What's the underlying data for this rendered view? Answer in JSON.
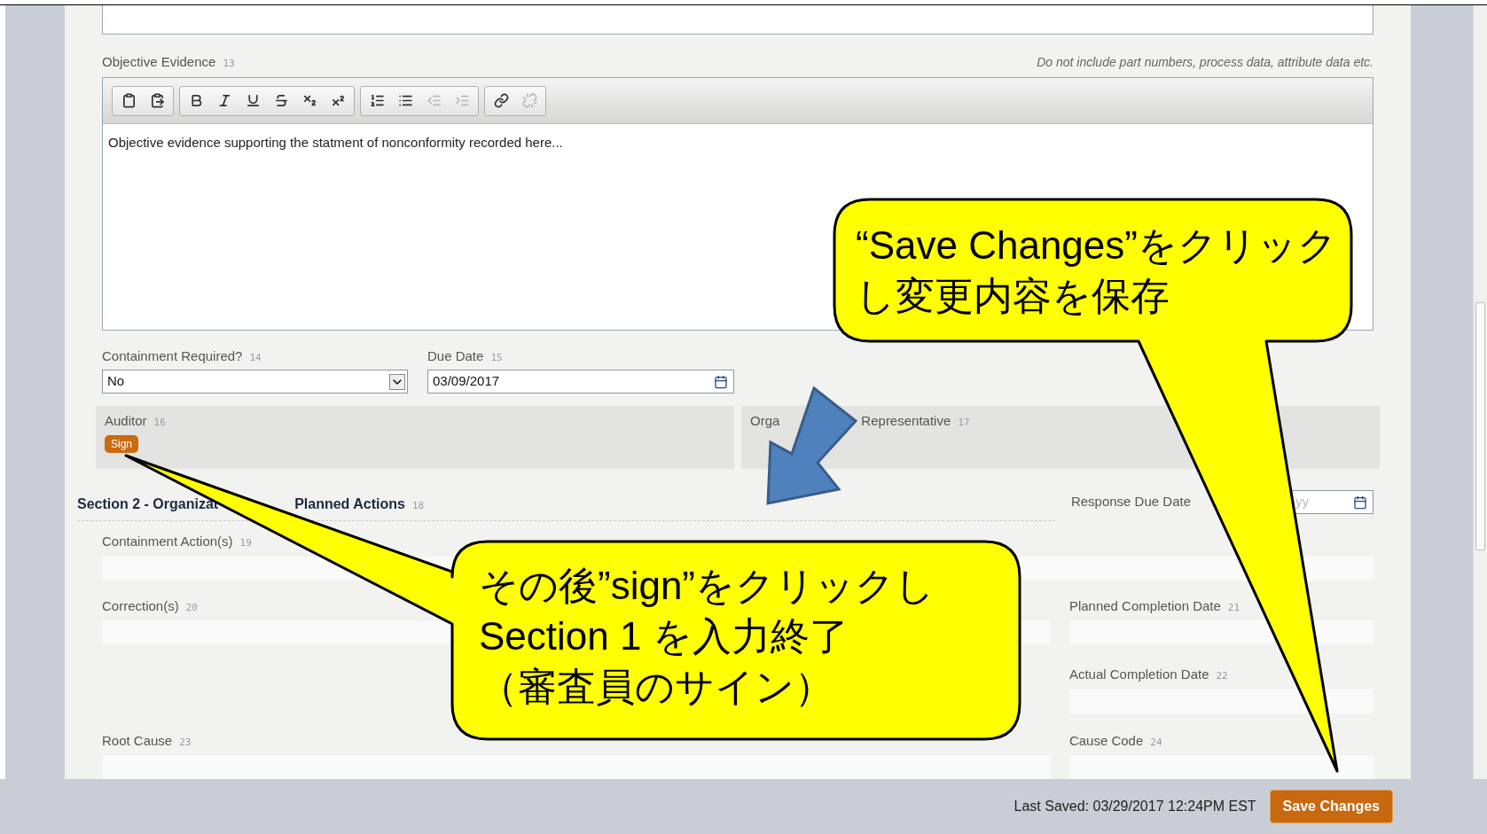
{
  "objective_evidence": {
    "label": "Objective Evidence",
    "number": "13",
    "hint": "Do not include part numbers, process data, attribute data etc.",
    "text": "Objective evidence supporting the statment of nonconformity recorded here...",
    "toolbar_groups": [
      [
        {
          "kind": "paste-text",
          "disabled": false
        },
        {
          "kind": "paste-word",
          "disabled": false
        }
      ],
      [
        {
          "kind": "bold",
          "disabled": false
        },
        {
          "kind": "italic",
          "disabled": false
        },
        {
          "kind": "underline",
          "disabled": false
        },
        {
          "kind": "strike",
          "disabled": false
        },
        {
          "kind": "subscript",
          "disabled": false
        },
        {
          "kind": "superscript",
          "disabled": false
        }
      ],
      [
        {
          "kind": "ordered-list",
          "disabled": false
        },
        {
          "kind": "bullet-list",
          "disabled": false
        },
        {
          "kind": "outdent",
          "disabled": true
        },
        {
          "kind": "indent",
          "disabled": true
        }
      ],
      [
        {
          "kind": "link",
          "disabled": false
        },
        {
          "kind": "unlink",
          "disabled": true
        }
      ]
    ]
  },
  "containment": {
    "label": "Containment Required?",
    "number": "14",
    "value": "No"
  },
  "due_date": {
    "label": "Due Date",
    "number": "15",
    "value": "03/09/2017"
  },
  "signatures": [
    {
      "label_parts": [
        "Auditor"
      ],
      "number": "16",
      "button": "Sign"
    },
    {
      "label_parts": [
        "Orga",
        "Representative"
      ],
      "number": "17"
    }
  ],
  "section2": {
    "title_parts": [
      "Section 2 - Organizat",
      "Planned Actions"
    ],
    "number": "18",
    "response_due": {
      "label": "Response Due Date",
      "placeholder": "yy"
    }
  },
  "fields": [
    {
      "label": "Containment Action(s)",
      "number": "19"
    },
    {
      "label": "Correction(s)",
      "number": "20"
    },
    {
      "label": "Planned Completion Date",
      "number": "21"
    },
    {
      "label": "Actual Completion Date",
      "number": "22"
    },
    {
      "label": "Root Cause",
      "number": "23"
    },
    {
      "label": "Cause Code",
      "number": "24"
    }
  ],
  "footer": {
    "last_saved": "Last Saved: 03/29/2017 12:24PM EST",
    "button": "Save Changes"
  },
  "callouts": [
    {
      "lines": [
        "“Save Changes”をクリック",
        "し変更内容を保存"
      ]
    },
    {
      "lines": [
        "その後”sign”をクリックし",
        "Section 1 を入力終了",
        "（審査員のサイン）"
      ]
    }
  ]
}
